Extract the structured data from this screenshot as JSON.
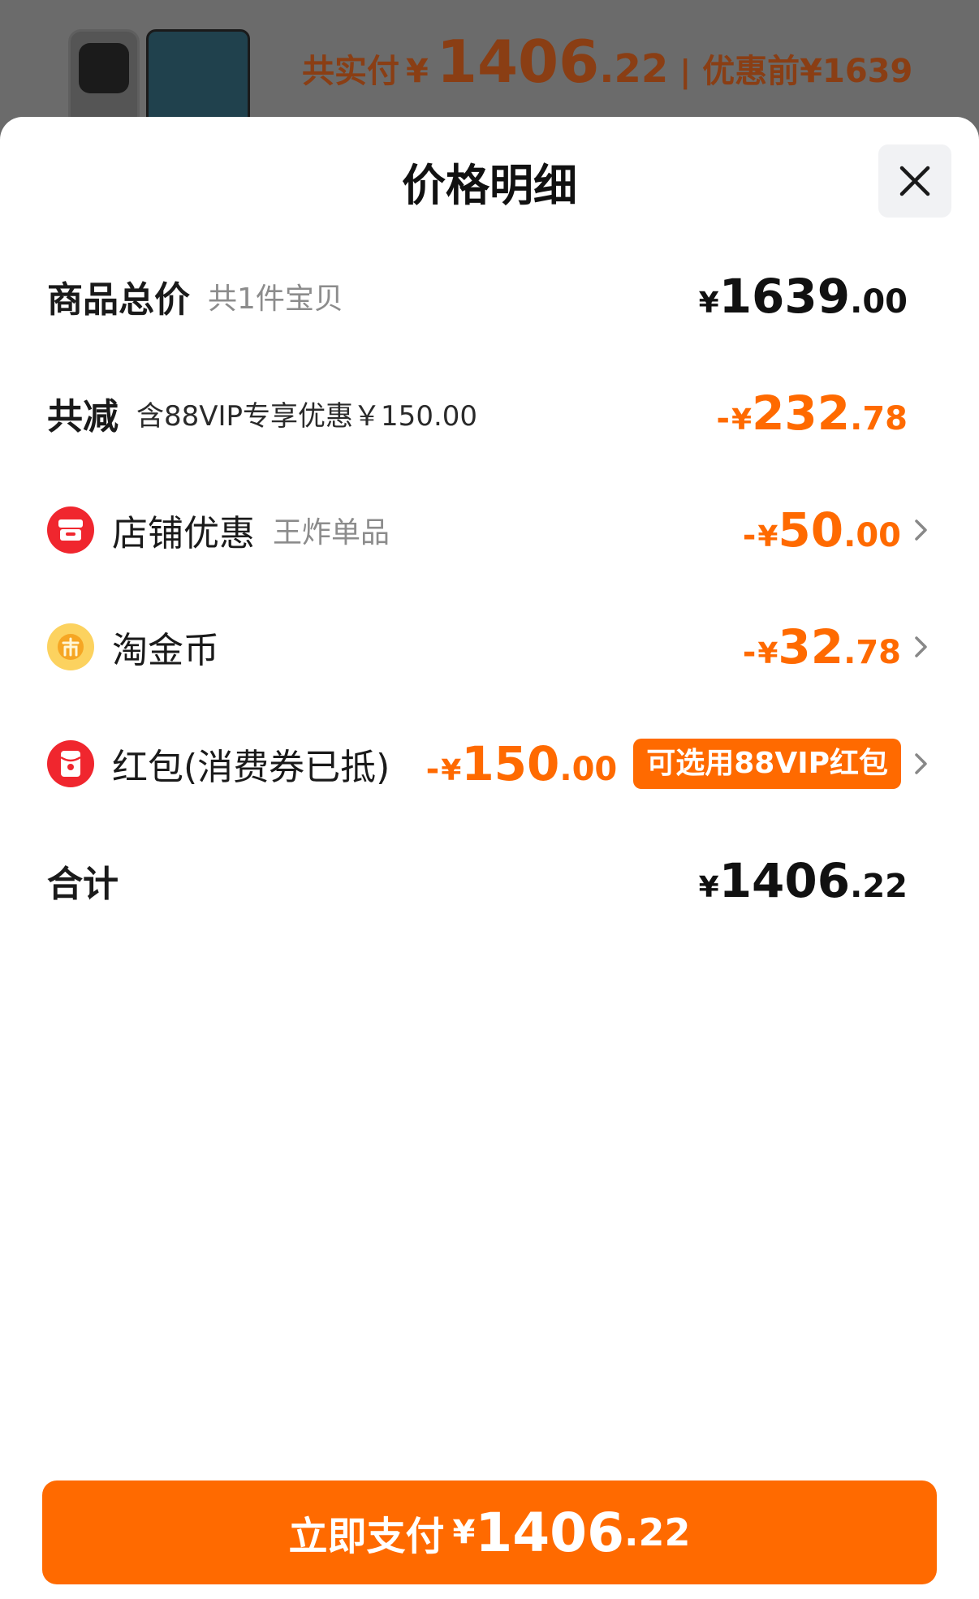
{
  "background_summary": {
    "label": "共实付",
    "currency": "¥",
    "amount_int": "1406",
    "amount_dec": ".22",
    "separator": "|",
    "before_text": "优惠前¥1639"
  },
  "sheet": {
    "title": "价格明细"
  },
  "rows": {
    "total": {
      "label": "商品总价",
      "sub": "共1件宝贝",
      "currency": "¥",
      "int": "1639",
      "dec": ".00"
    },
    "discount": {
      "label": "共减",
      "sub": "含88VIP专享优惠￥150.00",
      "minus": "-",
      "currency": "¥",
      "int": "232",
      "dec": ".78"
    },
    "shop": {
      "label": "店铺优惠",
      "sub": "王炸单品",
      "minus": "-",
      "currency": "¥",
      "int": "50",
      "dec": ".00",
      "icon": "store-icon"
    },
    "coins": {
      "label": "淘金币",
      "minus": "-",
      "currency": "¥",
      "int": "32",
      "dec": ".78",
      "icon": "coin-icon"
    },
    "redpacket": {
      "label": "红包(消费券已抵)",
      "minus": "-",
      "currency": "¥",
      "int": "150",
      "dec": ".00",
      "badge": "可选用88VIP红包",
      "icon": "red-packet-icon"
    },
    "sum": {
      "label": "合计",
      "currency": "¥",
      "int": "1406",
      "dec": ".22"
    }
  },
  "pay_button": {
    "label": "立即支付",
    "currency": "¥",
    "int": "1406",
    "dec": ".22"
  },
  "colors": {
    "accent": "#ff6a00",
    "red": "#f0262e",
    "gold": "#fcd25f",
    "muted": "#8c8c8c"
  }
}
